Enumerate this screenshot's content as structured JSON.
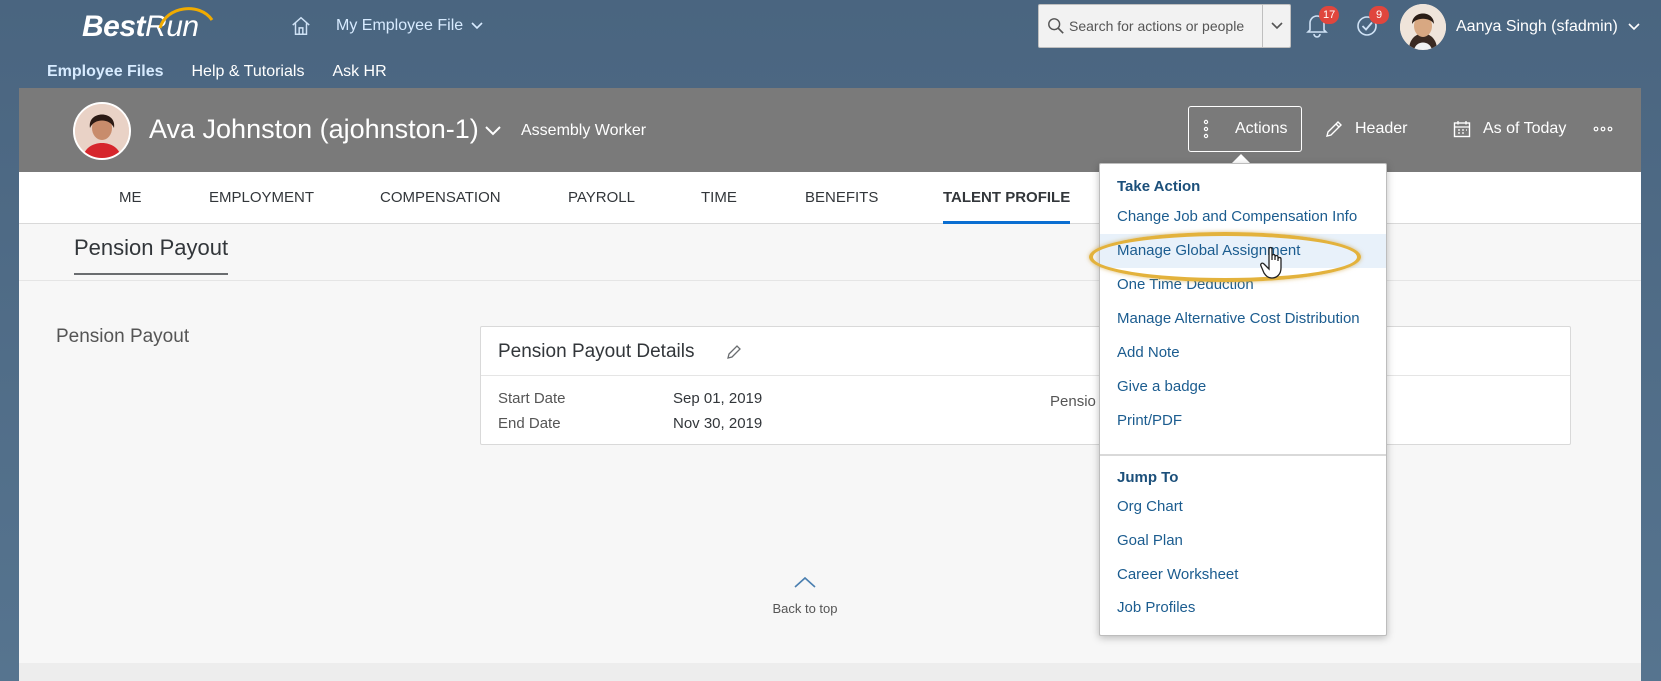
{
  "shell": {
    "logo_text_1": "Best",
    "logo_text_2": "Run",
    "app_menu_label": "My Employee File",
    "search_placeholder": "Search for actions or people",
    "notifications_count": "17",
    "tasks_count": "9",
    "user_name": "Aanya Singh (sfadmin)"
  },
  "subnav": {
    "items": [
      "Employee Files",
      "Help & Tutorials",
      "Ask HR"
    ]
  },
  "employee": {
    "name": "Ava Johnston (ajohnston-1)",
    "title": "Assembly Worker"
  },
  "header_actions": {
    "actions": "Actions",
    "header": "Header",
    "as_of": "As of Today"
  },
  "tabs": [
    "ME",
    "EMPLOYMENT",
    "COMPENSATION",
    "PAYROLL",
    "TIME",
    "BENEFITS",
    "TALENT PROFILE"
  ],
  "active_tab": "TALENT PROFILE",
  "section": {
    "title": "Pension Payout",
    "side_label": "Pension Payout"
  },
  "card": {
    "title": "Pension Payout Details",
    "start_label": "Start Date",
    "start_value": "Sep 01, 2019",
    "end_label": "End Date",
    "end_value": "Nov 30, 2019",
    "right_label_partial": "Pensio"
  },
  "back_to_top": "Back to top",
  "menu": {
    "group1": "Take Action",
    "items1": [
      "Change Job and Compensation Info",
      "Manage Global Assignment",
      "One Time Deduction",
      "Manage Alternative Cost Distribution",
      "Add Note",
      "Give a badge",
      "Print/PDF"
    ],
    "group2": "Jump To",
    "items2": [
      "Org Chart",
      "Goal Plan",
      "Career Worksheet",
      "Job Profiles"
    ],
    "hovered": "Manage Global Assignment"
  },
  "colors": {
    "shell_bg": "#4f6b85",
    "header_bar": "#7a7a7a",
    "link": "#1b5c8f",
    "badge": "#e0463d",
    "highlight_ring": "#e3b23c",
    "active_tab_underline": "#0a6ed1"
  }
}
